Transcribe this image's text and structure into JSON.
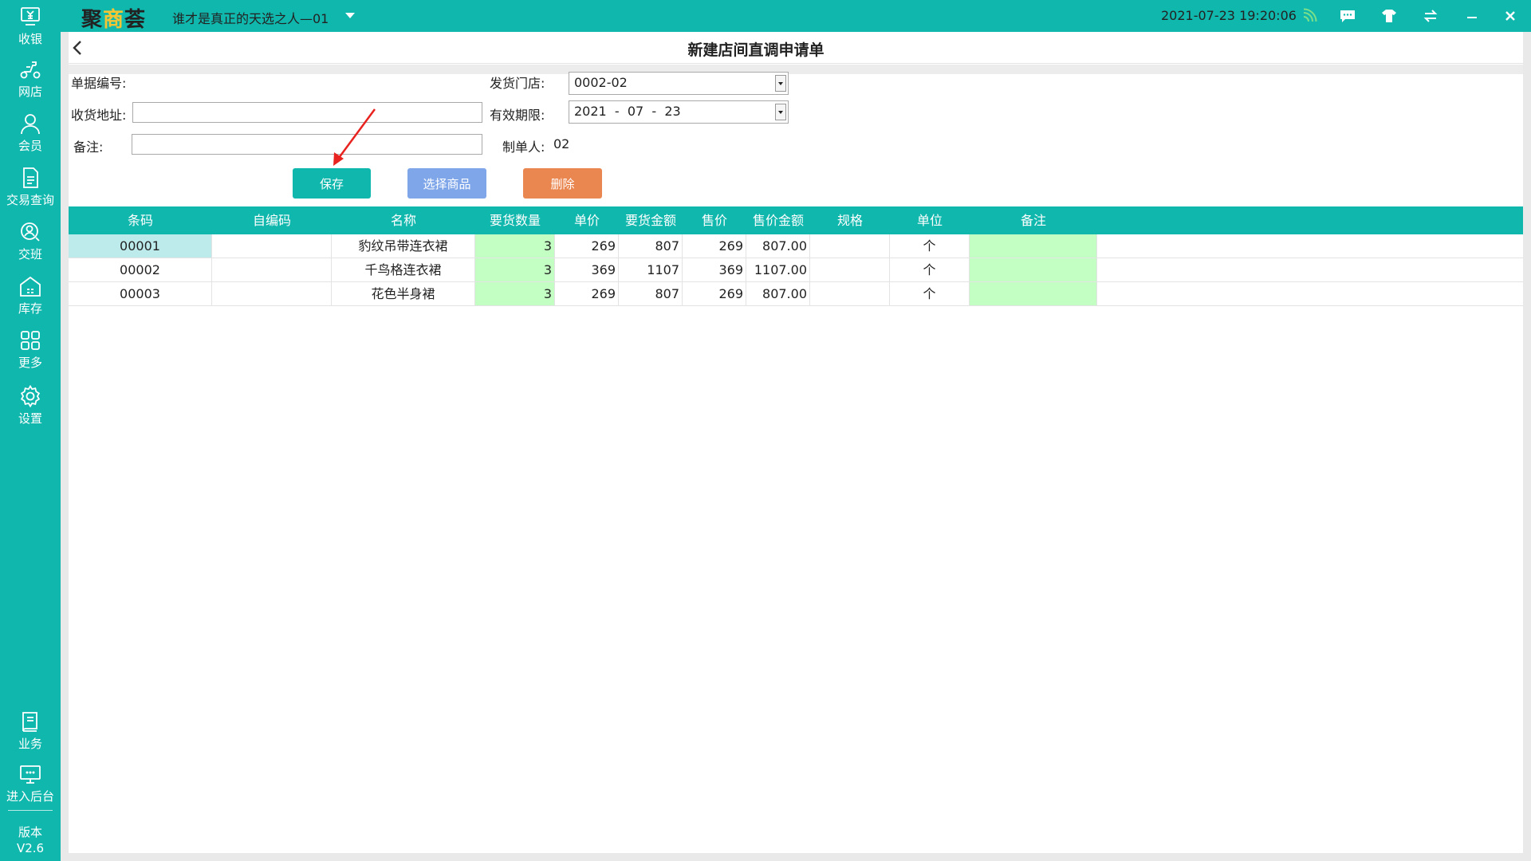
{
  "app": {
    "logo": "聚商荟",
    "store_name": "谁才是真正的天选之人—01",
    "datetime": "2021-07-23 19:20:06"
  },
  "sidebar": {
    "items": [
      {
        "label": "收银",
        "icon": "cashier-icon"
      },
      {
        "label": "网店",
        "icon": "scooter-icon"
      },
      {
        "label": "会员",
        "icon": "member-icon"
      },
      {
        "label": "交易查询",
        "icon": "document-icon"
      },
      {
        "label": "交班",
        "icon": "shift-icon"
      },
      {
        "label": "库存",
        "icon": "warehouse-icon"
      },
      {
        "label": "更多",
        "icon": "grid-icon"
      },
      {
        "label": "设置",
        "icon": "gear-icon"
      }
    ],
    "bottom_items": [
      {
        "label": "业务",
        "icon": "book-icon"
      },
      {
        "label": "进入后台",
        "icon": "monitor-icon"
      }
    ],
    "version_label": "版本",
    "version_value": "V2.6"
  },
  "page": {
    "title": "新建店间直调申请单"
  },
  "form": {
    "doc_no_label": "单据编号:",
    "address_label": "收货地址:",
    "address_value": "",
    "remark_label": "备注:",
    "remark_value": "",
    "ship_store_label": "发货门店:",
    "ship_store_value": "0002-02",
    "valid_label": "有效期限:",
    "valid_value": "2021  -  07  -  23",
    "creator_label": "制单人:",
    "creator_value": "02"
  },
  "buttons": {
    "save": "保存",
    "select_goods": "选择商品",
    "delete": "删除"
  },
  "table": {
    "headers": [
      "条码",
      "自编码",
      "名称",
      "要货数量",
      "单价",
      "要货金额",
      "售价",
      "售价金额",
      "规格",
      "单位",
      "备注"
    ],
    "rows": [
      {
        "barcode": "00001",
        "code": "",
        "name": "豹纹吊带连衣裙",
        "qty": "3",
        "price": "269",
        "amount": "807",
        "sale_price": "269",
        "sale_amount": "807.00",
        "spec": "",
        "unit": "个",
        "remark": ""
      },
      {
        "barcode": "00002",
        "code": "",
        "name": "千鸟格连衣裙",
        "qty": "3",
        "price": "369",
        "amount": "1107",
        "sale_price": "369",
        "sale_amount": "1107.00",
        "spec": "",
        "unit": "个",
        "remark": ""
      },
      {
        "barcode": "00003",
        "code": "",
        "name": "花色半身裙",
        "qty": "3",
        "price": "269",
        "amount": "807",
        "sale_price": "269",
        "sale_amount": "807.00",
        "spec": "",
        "unit": "个",
        "remark": ""
      }
    ]
  },
  "colors": {
    "brand": "#10b7ad",
    "save_button": "#10b7ad",
    "select_button": "#7fa6e9",
    "delete_button": "#ea864f",
    "editable_cell": "#c3ffc3",
    "annotation_arrow": "#e8231f"
  }
}
